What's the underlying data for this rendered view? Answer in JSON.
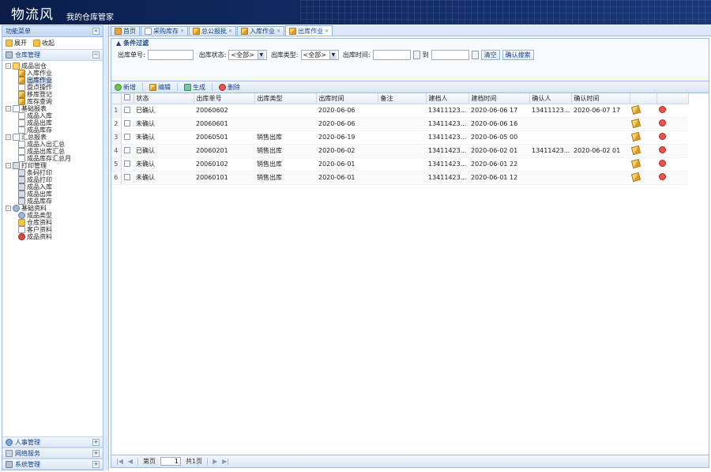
{
  "banner": {
    "title": "物流风",
    "subtitle": "我的仓库管家"
  },
  "left": {
    "header": "功能菜单",
    "toolbar": {
      "expand": "展开",
      "collapse": "收起"
    },
    "section_main": "仓库管理",
    "tree": [
      {
        "level": 1,
        "label": "成品出仓",
        "icon": "folder-open-icon",
        "expander": "-"
      },
      {
        "level": 2,
        "label": "入库作业",
        "icon": "pen-icon"
      },
      {
        "level": 2,
        "label": "出库作业",
        "icon": "pen-icon",
        "selected": true
      },
      {
        "level": 2,
        "label": "盘点操作",
        "icon": "doc-icon"
      },
      {
        "level": 2,
        "label": "移库登记",
        "icon": "pen-icon"
      },
      {
        "level": 2,
        "label": "库存查询",
        "icon": "pen-icon"
      },
      {
        "level": 1,
        "label": "基础报表",
        "icon": "doc-icon",
        "expander": "-"
      },
      {
        "level": 2,
        "label": "成品入库",
        "icon": "doc-icon"
      },
      {
        "level": 2,
        "label": "成品出库",
        "icon": "doc-icon"
      },
      {
        "level": 2,
        "label": "成品库存",
        "icon": "doc-icon"
      },
      {
        "level": 1,
        "label": "汇总报表",
        "icon": "doc-icon",
        "expander": "-"
      },
      {
        "level": 2,
        "label": "成品入出汇总",
        "icon": "doc-icon"
      },
      {
        "level": 2,
        "label": "成品出库汇总",
        "icon": "doc-icon"
      },
      {
        "level": 2,
        "label": "成品库存汇总月",
        "icon": "doc-icon"
      },
      {
        "level": 1,
        "label": "打印管理",
        "icon": "print-icon",
        "expander": "-"
      },
      {
        "level": 2,
        "label": "条码打印",
        "icon": "print-icon"
      },
      {
        "level": 2,
        "label": "成品打印",
        "icon": "print-icon"
      },
      {
        "level": 2,
        "label": "成品入库",
        "icon": "print-icon"
      },
      {
        "level": 2,
        "label": "成品出库",
        "icon": "print-icon"
      },
      {
        "level": 2,
        "label": "成品库存",
        "icon": "print-icon"
      },
      {
        "level": 1,
        "label": "基础资料",
        "icon": "gear-icon",
        "expander": "-"
      },
      {
        "level": 2,
        "label": "成品类型",
        "icon": "gear-icon"
      },
      {
        "level": 2,
        "label": "仓库资料",
        "icon": "folder-icon"
      },
      {
        "level": 2,
        "label": "客户资料",
        "icon": "doc-icon"
      },
      {
        "level": 2,
        "label": "成品资料",
        "icon": "globe-icon"
      }
    ],
    "bottom_sections": [
      {
        "label": "人事管理",
        "icon": "users-icon"
      },
      {
        "label": "网络服务",
        "icon": "net-icon"
      },
      {
        "label": "系统管理",
        "icon": "sys-icon"
      }
    ]
  },
  "tabs": [
    {
      "label": "首页",
      "icon": "home-icon",
      "closable": false
    },
    {
      "label": "采购库存",
      "icon": "doc-icon",
      "closable": true
    },
    {
      "label": "总公报批",
      "icon": "pen-icon",
      "closable": true
    },
    {
      "label": "入库作业",
      "icon": "pen-icon",
      "closable": true
    },
    {
      "label": "出库作业",
      "icon": "pen-icon",
      "closable": true,
      "active": true
    }
  ],
  "filter": {
    "title": "条件过滤",
    "order_no_label": "出库单号:",
    "status_label": "出库状态:",
    "status_value": "<全部>",
    "type_label": "出库类型:",
    "type_value": "<全部>",
    "time_label": "出库时间:",
    "to_label": "到",
    "clear_button": "清空",
    "query_button": "确认搜索"
  },
  "grid_toolbar": {
    "add": "新增",
    "edit": "编辑",
    "generate": "生成",
    "delete": "删除"
  },
  "columns": [
    "状态",
    "出库单号",
    "出库类型",
    "出库时间",
    "备注",
    "建档人",
    "建档时间",
    "确认人",
    "确认时间"
  ],
  "rows": [
    {
      "n": "1",
      "status": "已确认",
      "no": "20060602",
      "type": "",
      "time": "2020-06-06",
      "remark": "",
      "creator": "13411123...",
      "created": "2020-06-06 17",
      "confirmer": "13411123...",
      "confirmed": "2020-06-07 17"
    },
    {
      "n": "2",
      "status": "未确认",
      "no": "20060601",
      "type": "",
      "time": "2020-06-06",
      "remark": "",
      "creator": "13411423...",
      "created": "2020-06-06 16",
      "confirmer": "",
      "confirmed": ""
    },
    {
      "n": "3",
      "status": "未确认",
      "no": "20060501",
      "type": "销售出库",
      "time": "2020-06-19",
      "remark": "",
      "creator": "13411423...",
      "created": "2020-06-05 00",
      "confirmer": "",
      "confirmed": ""
    },
    {
      "n": "4",
      "status": "已确认",
      "no": "20060201",
      "type": "销售出库",
      "time": "2020-06-02",
      "remark": "",
      "creator": "13411423...",
      "created": "2020-06-02 01",
      "confirmer": "13411423...",
      "confirmed": "2020-06-02 01"
    },
    {
      "n": "5",
      "status": "未确认",
      "no": "20060102",
      "type": "销售出库",
      "time": "2020-06-01",
      "remark": "",
      "creator": "13411423...",
      "created": "2020-06-01 22",
      "confirmer": "",
      "confirmed": ""
    },
    {
      "n": "6",
      "status": "未确认",
      "no": "20060101",
      "type": "销售出库",
      "time": "2020-06-01",
      "remark": "",
      "creator": "13411423...",
      "created": "2020-06-01 12",
      "confirmer": "",
      "confirmed": ""
    }
  ],
  "pager": {
    "page_label": "第页",
    "page_value": "1",
    "total_label": "共1页"
  }
}
